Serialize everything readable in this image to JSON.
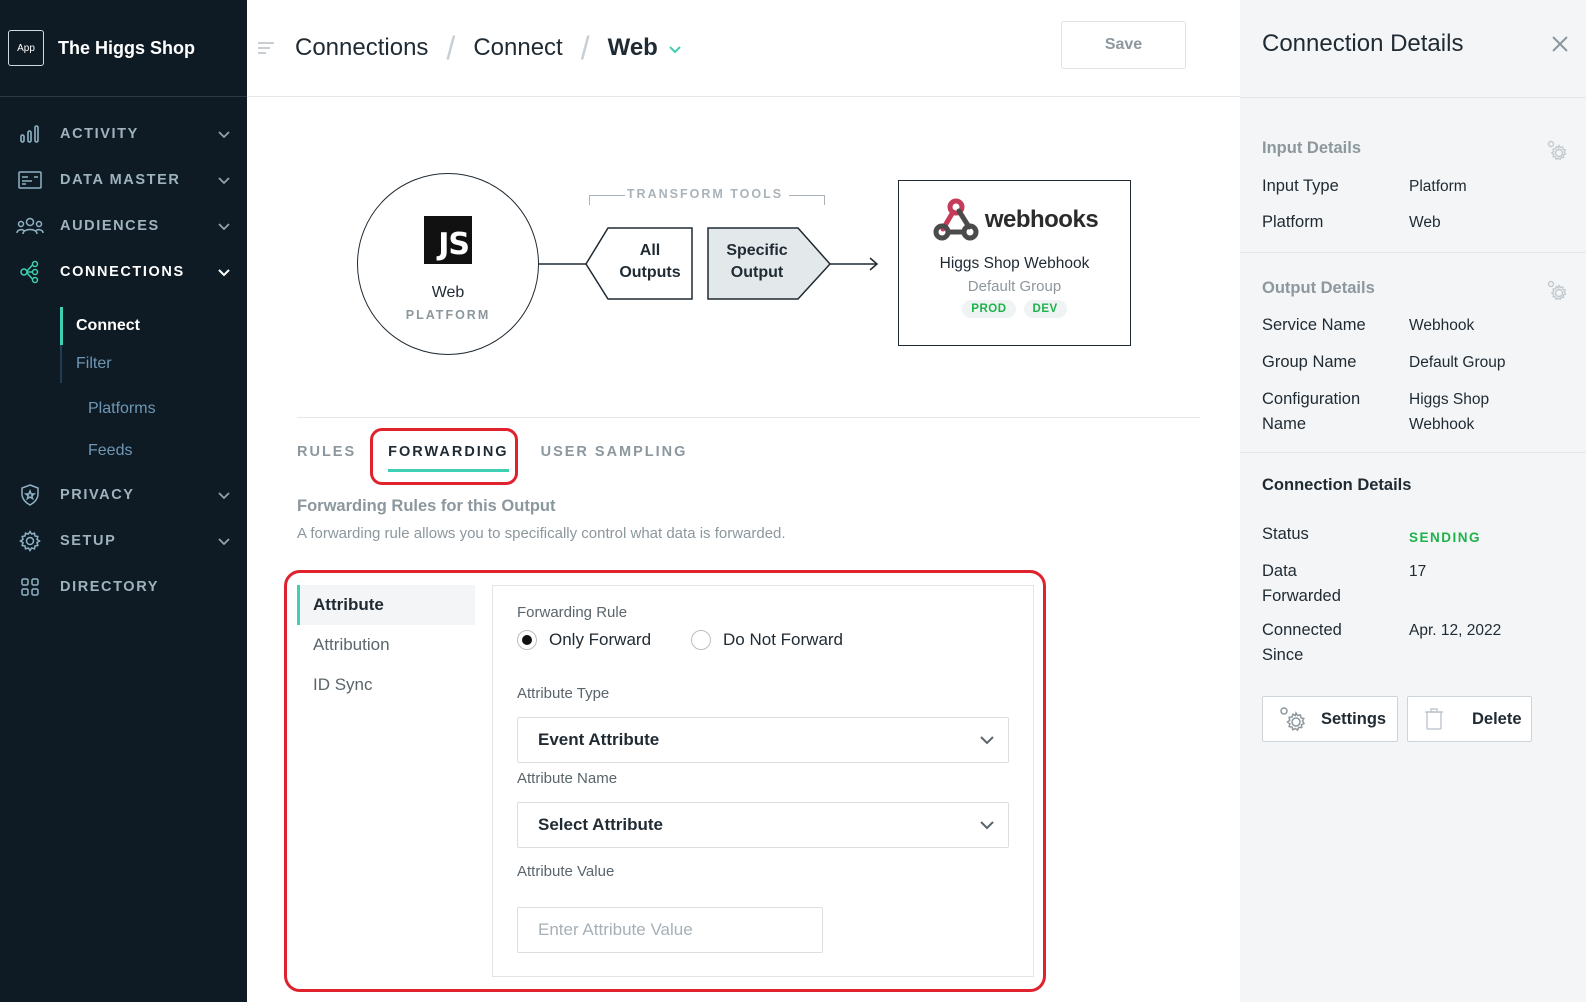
{
  "app": {
    "badge": "App",
    "name": "The Higgs Shop"
  },
  "sidebar": {
    "items": [
      {
        "label": "ACTIVITY",
        "icon": "bar-chart-icon"
      },
      {
        "label": "DATA MASTER",
        "icon": "data-master-icon"
      },
      {
        "label": "AUDIENCES",
        "icon": "audiences-icon"
      },
      {
        "label": "CONNECTIONS",
        "icon": "connections-icon"
      },
      {
        "label": "PRIVACY",
        "icon": "shield-icon"
      },
      {
        "label": "SETUP",
        "icon": "gear-icon"
      },
      {
        "label": "DIRECTORY",
        "icon": "grid-icon"
      }
    ],
    "connections_sub": {
      "connect": "Connect",
      "filter": "Filter",
      "platforms": "Platforms",
      "feeds": "Feeds"
    }
  },
  "topbar": {
    "breadcrumbs": [
      "Connections",
      "Connect",
      "Web"
    ],
    "save_label": "Save"
  },
  "diagram": {
    "input": {
      "logo": "JS",
      "name": "Web",
      "type": "PLATFORM"
    },
    "transform_label": "TRANSFORM TOOLS",
    "all_outputs": {
      "line1": "All",
      "line2": "Outputs"
    },
    "specific_output": {
      "line1": "Specific",
      "line2": "Output"
    },
    "output": {
      "brand": "webhooks",
      "name": "Higgs Shop Webhook",
      "group": "Default Group",
      "tags": [
        "PROD",
        "DEV"
      ]
    }
  },
  "tabs": [
    "RULES",
    "FORWARDING",
    "USER SAMPLING"
  ],
  "forwarding": {
    "title": "Forwarding Rules for this Output",
    "description": "A forwarding rule allows you to specifically control what data is forwarded.",
    "side_options": [
      "Attribute",
      "Attribution",
      "ID Sync"
    ],
    "rule_label": "Forwarding Rule",
    "rule_options": [
      "Only Forward",
      "Do Not Forward"
    ],
    "attr_type_label": "Attribute Type",
    "attr_type_value": "Event Attribute",
    "attr_name_label": "Attribute Name",
    "attr_name_value": "Select Attribute",
    "attr_value_label": "Attribute Value",
    "attr_value_placeholder": "Enter Attribute Value"
  },
  "details": {
    "title": "Connection Details",
    "input": {
      "title": "Input Details",
      "rows": [
        {
          "k": "Input Type",
          "v": "Platform"
        },
        {
          "k": "Platform",
          "v": "Web"
        }
      ]
    },
    "output": {
      "title": "Output Details",
      "rows": [
        {
          "k": "Service Name",
          "v": "Webhook"
        },
        {
          "k": "Group Name",
          "v": "Default Group"
        },
        {
          "k1": "Configuration",
          "k2": "Name",
          "v1": "Higgs Shop",
          "v2": "Webhook"
        }
      ]
    },
    "connection": {
      "title": "Connection Details",
      "status_label": "Status",
      "status_value": "SENDING",
      "forwarded_label1": "Data",
      "forwarded_label2": "Forwarded",
      "forwarded_value": "17",
      "since_label1": "Connected",
      "since_label2": "Since",
      "since_value": "Apr. 12, 2022"
    },
    "settings_label": "Settings",
    "delete_label": "Delete"
  },
  "colors": {
    "sidebar_bg": "#0f1b24",
    "accent": "#3fd0b3",
    "highlight": "#e0212e",
    "status_green": "#1eb34a"
  }
}
